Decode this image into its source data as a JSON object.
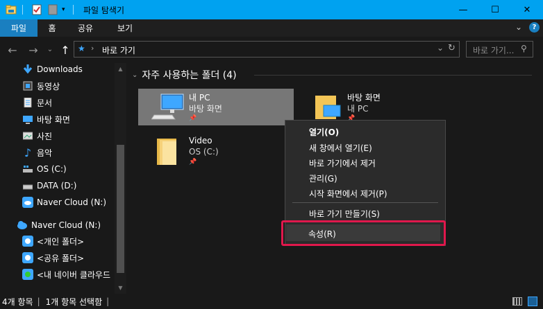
{
  "window": {
    "title": "파일 탐색기",
    "minimize_glyph": "—",
    "maximize_glyph": "☐",
    "close_glyph": "✕"
  },
  "ribbon": {
    "tabs": [
      {
        "label": "파일",
        "active": true
      },
      {
        "label": "홈",
        "active": false
      },
      {
        "label": "공유",
        "active": false
      },
      {
        "label": "보기",
        "active": false
      }
    ]
  },
  "navigation": {
    "address_path": "바로 가기",
    "search_placeholder": "바로 가기..."
  },
  "sidebar": {
    "items": [
      {
        "label": "Downloads",
        "icon": "download-arrow-icon"
      },
      {
        "label": "동영상",
        "icon": "film-icon"
      },
      {
        "label": "문서",
        "icon": "document-icon"
      },
      {
        "label": "바탕 화면",
        "icon": "desktop-icon"
      },
      {
        "label": "사진",
        "icon": "pictures-icon"
      },
      {
        "label": "음악",
        "icon": "music-note-icon"
      },
      {
        "label": "OS (C:)",
        "icon": "windows-drive-icon"
      },
      {
        "label": "DATA (D:)",
        "icon": "drive-icon"
      },
      {
        "label": "Naver Cloud (N:)",
        "icon": "cloud-drive-icon"
      },
      {
        "label": "Naver Cloud (N:)",
        "icon": "cloud-icon"
      },
      {
        "label": "<개인 폴더>",
        "icon": "cloud-folder-icon"
      },
      {
        "label": "<공유 폴더>",
        "icon": "cloud-folder-icon"
      },
      {
        "label": "<내 네이버 클라우드",
        "icon": "cloud-folder-green-icon"
      }
    ]
  },
  "main": {
    "group_title": "자주 사용하는 폴더 (4)",
    "tiles": [
      {
        "name": "내 PC",
        "sub": "바탕 화면",
        "icon": "computer-icon",
        "selected": true
      },
      {
        "name": "바탕 화면",
        "sub": "내 PC",
        "icon": "desktop-folder-icon",
        "selected": false
      },
      {
        "name": "Video",
        "sub": "OS (C:)",
        "icon": "folder-icon",
        "selected": false
      }
    ]
  },
  "context_menu": {
    "items": [
      {
        "label": "열기(O)",
        "bold": true
      },
      {
        "label": "새 창에서 열기(E)",
        "bold": false
      },
      {
        "label": "바로 가기에서 제거",
        "bold": false
      },
      {
        "label": "관리(G)",
        "bold": false
      },
      {
        "label": "시작 화면에서 제거(P)",
        "bold": false
      },
      {
        "label": "바로 가기 만들기(S)",
        "bold": false
      },
      {
        "label": "속성(R)",
        "bold": false,
        "highlighted": true
      }
    ]
  },
  "status": {
    "item_count": "4개 항목",
    "selected_count": "1개 항목 선택함"
  },
  "colors": {
    "titlebar": "#00a2f0",
    "active_tab": "#1a7fc0",
    "highlight_border": "#e0184c",
    "background": "#191919"
  }
}
